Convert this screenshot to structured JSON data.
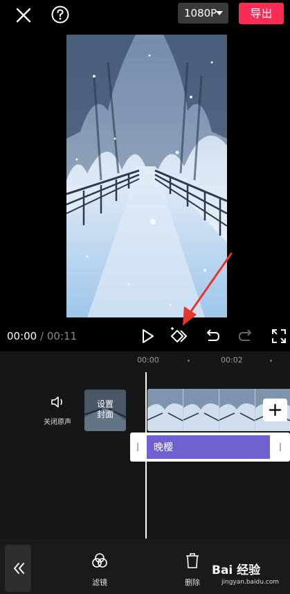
{
  "topbar": {
    "resolution_label": "1080P",
    "export_label": "导出"
  },
  "player": {
    "current_time": "00:00",
    "separator": "/",
    "total_time": "00:11"
  },
  "timeline": {
    "ticks": [
      "00:00",
      "00:02"
    ],
    "mute_label": "关闭原声",
    "cover_label": "设置\n封面",
    "audio_clip_label": "晚樱"
  },
  "bottom_toolbar": {
    "items": [
      {
        "label": "滤镜",
        "icon": "filter-icon"
      },
      {
        "label": "删除",
        "icon": "trash-icon"
      }
    ]
  },
  "watermark": {
    "text": "Bai 经验",
    "url": "jingyan.baidu.com"
  },
  "colors": {
    "accent": "#fe2c55",
    "audio_clip": "#6f62d0",
    "background": "#000000"
  }
}
